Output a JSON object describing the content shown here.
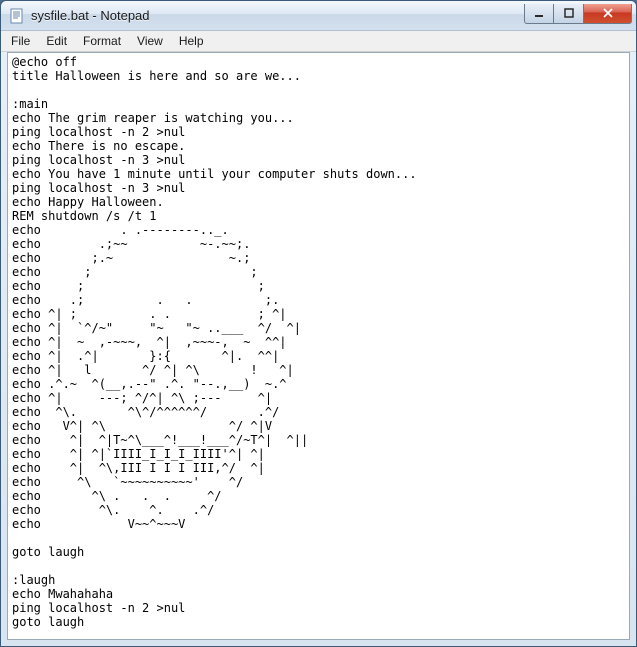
{
  "window": {
    "title": "sysfile.bat - Notepad"
  },
  "menu": {
    "file": "File",
    "edit": "Edit",
    "format": "Format",
    "view": "View",
    "help": "Help"
  },
  "document": {
    "text": "@echo off\ntitle Halloween is here and so are we...\n\n:main\necho The grim reaper is watching you...\nping localhost -n 2 >nul\necho There is no escape.\nping localhost -n 3 >nul\necho You have 1 minute until your computer shuts down...\nping localhost -n 3 >nul\necho Happy Halloween.\nREM shutdown /s /t 1\necho           . .--------.._.\necho        .;~~          ~-.~~;.\necho       ;.~                ~.;\necho      ;                      ;\necho     ;                        ;\necho    .;          .   .          ;.\necho ^| ;          . .            ; ^|\necho ^|  `^/~\"     \"~   \"~ ..___  ^/  ^|\necho ^|  ~  ,-~~~,  ^|  ,~~~-,  ~  ^^|\necho ^|  .^|       }:{       ^|.  ^^|\necho ^|   l       ^/ ^| ^\\       !   ^|\necho .^.~  ^(__,.--\" .^. \"--.,__)  ~.^\necho ^|     ---; ^/^| ^\\ ;---     ^|\necho  ^\\.       ^\\^/^^^^^^/       .^/\necho   V^| ^\\                 ^/ ^|V\necho    ^|  ^|T~^\\___^!___!___^/~T^|  ^||\necho    ^| ^|`IIII_I_I_I_IIII'^| ^|\necho    ^|  ^\\,III I I I III,^/  ^|\necho     ^\\   `~~~~~~~~~~'    ^/\necho       ^\\ .   .  .     ^/\necho        ^\\.    ^.    .^/\necho            V~~^~~~V\n\ngoto laugh\n\n:laugh\necho Mwahahaha\nping localhost -n 2 >nul\ngoto laugh"
  },
  "colors": {
    "titlebar_top": "#f4f8fc",
    "titlebar_bottom": "#cad8e8",
    "close_red": "#d05030",
    "client_bg": "#ffffff"
  }
}
